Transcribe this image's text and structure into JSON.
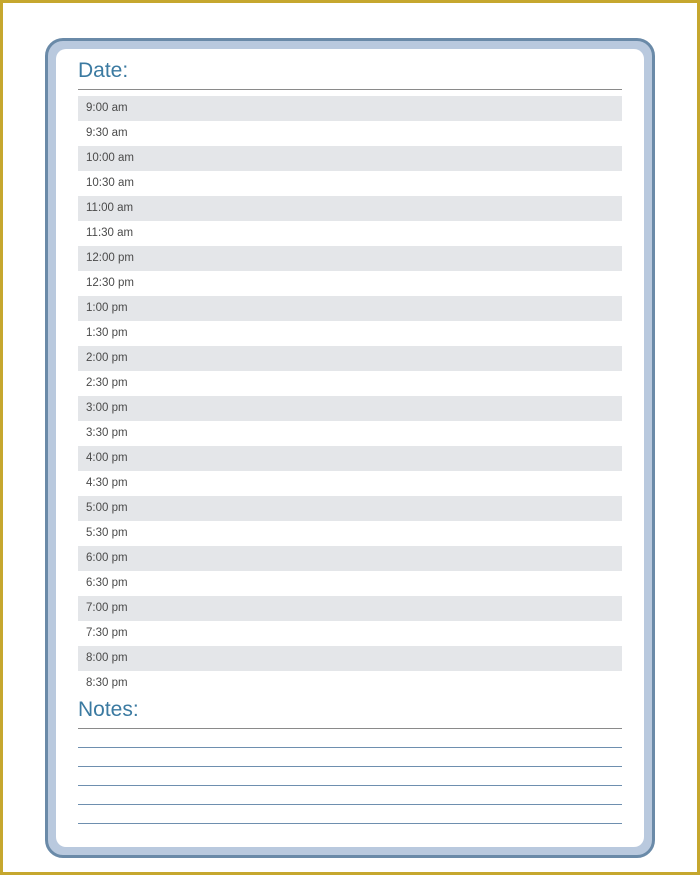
{
  "headings": {
    "date": "Date:",
    "notes": "Notes:"
  },
  "time_slots": [
    "9:00 am",
    "9:30 am",
    "10:00 am",
    "10:30 am",
    "11:00 am",
    "11:30 am",
    "12:00 pm",
    "12:30 pm",
    "1:00 pm",
    "1:30 pm",
    "2:00 pm",
    "2:30 pm",
    "3:00 pm",
    "3:30 pm",
    "4:00 pm",
    "4:30 pm",
    "5:00 pm",
    "5:30 pm",
    "6:00 pm",
    "6:30 pm",
    "7:00 pm",
    "7:30 pm",
    "8:00 pm",
    "8:30 pm"
  ],
  "note_line_count": 5
}
